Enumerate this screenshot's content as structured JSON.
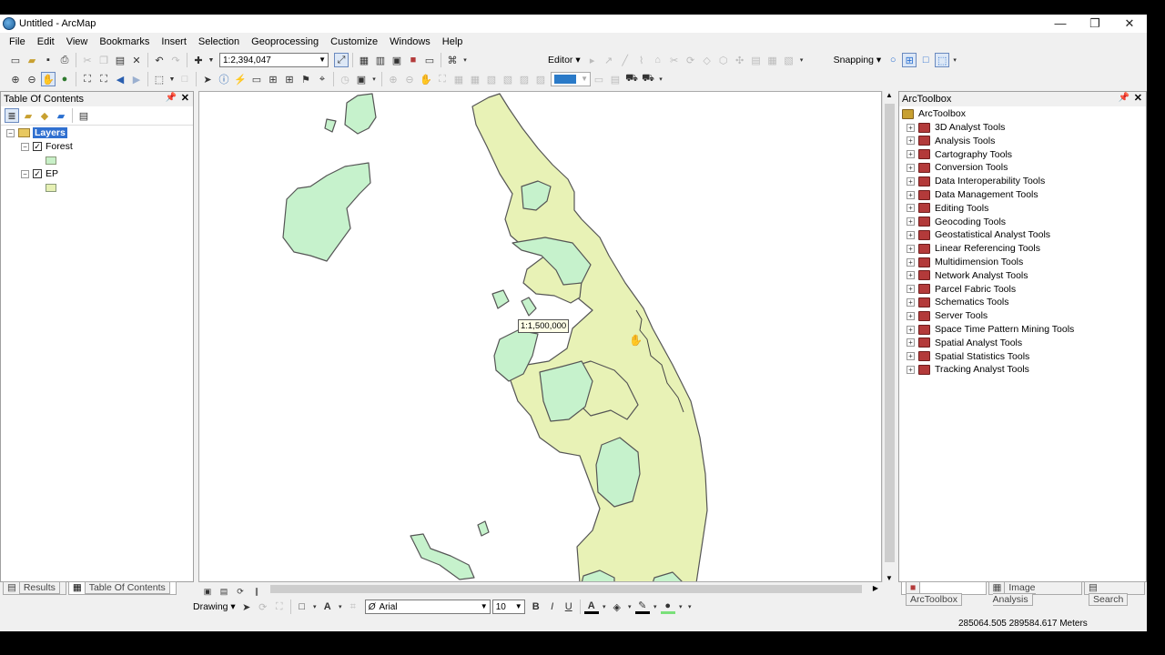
{
  "window": {
    "title": "Untitled - ArcMap",
    "minimize": "—",
    "maximize": "❐",
    "close": "✕"
  },
  "menu": [
    "File",
    "Edit",
    "View",
    "Bookmarks",
    "Insert",
    "Selection",
    "Geoprocessing",
    "Customize",
    "Windows",
    "Help"
  ],
  "toolbar": {
    "scale_value": "1:2,394,047",
    "editor_label": "Editor ▾",
    "snapping_label": "Snapping ▾",
    "drawing_label": "Drawing ▾",
    "font_name": "Arial",
    "font_size": "10",
    "bold": "B",
    "italic": "I",
    "underline": "U",
    "font_color_glyph": "A"
  },
  "toc": {
    "title": "Table Of Contents",
    "root": "Layers",
    "layers": [
      {
        "name": "Forest",
        "checked": true,
        "color": "#c8f0c8"
      },
      {
        "name": "EP",
        "checked": true,
        "color": "#e6f0b4"
      }
    ]
  },
  "toolbox": {
    "title": "ArcToolbox",
    "root": "ArcToolbox",
    "items": [
      "3D Analyst Tools",
      "Analysis Tools",
      "Cartography Tools",
      "Conversion Tools",
      "Data Interoperability Tools",
      "Data Management Tools",
      "Editing Tools",
      "Geocoding Tools",
      "Geostatistical Analyst Tools",
      "Linear Referencing Tools",
      "Multidimension Tools",
      "Network Analyst Tools",
      "Parcel Fabric Tools",
      "Schematics Tools",
      "Server Tools",
      "Space Time Pattern Mining Tools",
      "Spatial Analyst Tools",
      "Spatial Statistics Tools",
      "Tracking Analyst Tools"
    ]
  },
  "map": {
    "scale_tip": "1:1,500,000",
    "forest_color": "#c6f2cc",
    "ep_color": "#e8f2b6",
    "outline": "#555555"
  },
  "left_tabs": [
    "Results",
    "Table Of Contents"
  ],
  "right_tabs": [
    "ArcToolbox",
    "Image Analysis",
    "Search"
  ],
  "status": {
    "coordinates": "285064.505  289584.617 Meters"
  }
}
